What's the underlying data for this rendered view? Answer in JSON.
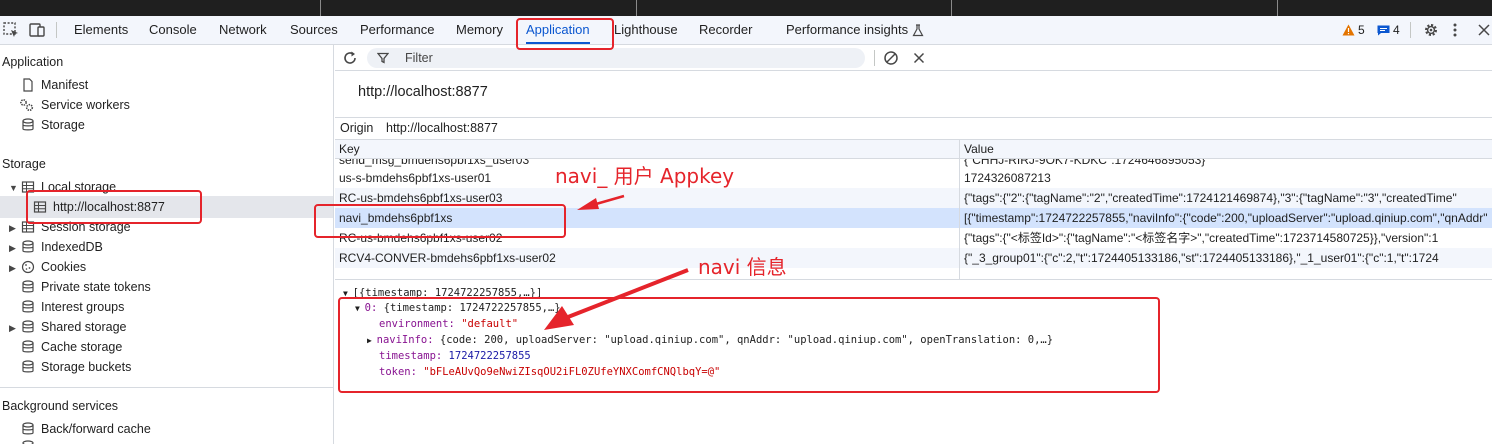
{
  "tabs": [
    {
      "label": "Elements"
    },
    {
      "label": "Console"
    },
    {
      "label": "Network"
    },
    {
      "label": "Sources"
    },
    {
      "label": "Performance"
    },
    {
      "label": "Memory"
    },
    {
      "label": "Application"
    },
    {
      "label": "Lighthouse"
    },
    {
      "label": "Recorder"
    },
    {
      "label": "Performance insights"
    }
  ],
  "badges": {
    "warnings": "5",
    "messages": "4"
  },
  "sidebar": {
    "application_title": "Application",
    "app_items": [
      {
        "label": "Manifest",
        "icon": "file-icon"
      },
      {
        "label": "Service workers",
        "icon": "gears-icon"
      },
      {
        "label": "Storage",
        "icon": "database-icon"
      }
    ],
    "storage_title": "Storage",
    "storage_items": [
      {
        "label": "Local storage"
      },
      {
        "label": "http://localhost:8877"
      },
      {
        "label": "Session storage"
      },
      {
        "label": "IndexedDB"
      },
      {
        "label": "Cookies"
      },
      {
        "label": "Private state tokens"
      },
      {
        "label": "Interest groups"
      },
      {
        "label": "Shared storage"
      },
      {
        "label": "Cache storage"
      },
      {
        "label": "Storage buckets"
      }
    ],
    "bg_title": "Background services",
    "bg_items": [
      {
        "label": "Back/forward cache"
      }
    ]
  },
  "toolbar": {
    "filter_placeholder": "Filter"
  },
  "origin": {
    "title": "http://localhost:8877",
    "label": "Origin",
    "value": "http://localhost:8877"
  },
  "table": {
    "headers": {
      "key": "Key",
      "value": "Value"
    },
    "rows": [
      {
        "key": "send_msg_bmdehs6pbf1xs_user03",
        "value": "{\"CHHJ-RIRJ-9OK7-KDKC\":1724646895053}"
      },
      {
        "key": "us-s-bmdehs6pbf1xs-user01",
        "value": "1724326087213"
      },
      {
        "key": "RC-us-bmdehs6pbf1xs-user03",
        "value": "{\"tags\":{\"2\":{\"tagName\":\"2\",\"createdTime\":1724121469874},\"3\":{\"tagName\":\"3\",\"createdTime\""
      },
      {
        "key": "navi_bmdehs6pbf1xs",
        "value": "[{\"timestamp\":1724722257855,\"naviInfo\":{\"code\":200,\"uploadServer\":\"upload.qiniup.com\",\"qnAddr\""
      },
      {
        "key": "RC-us-bmdehs6pbf1xs-user02",
        "value": "{\"tags\":{\"<标签Id>\":{\"tagName\":\"<标签名字>\",\"createdTime\":1723714580725}},\"version\":1"
      },
      {
        "key": "RCV4-CONVER-bmdehs6pbf1xs-user02",
        "value": "{\"_3_group01\":{\"c\":2,\"t\":1724405133186,\"st\":1724405133186},\"_1_user01\":{\"c\":1,\"t\":1724"
      }
    ]
  },
  "preview": {
    "root": "[{timestamp: 1724722257855,…}]",
    "item_index": "0:",
    "item_summary": "{timestamp: 1724722257855,…}",
    "fields": [
      {
        "key": "environment:",
        "value": "\"default\"",
        "kind": "str"
      },
      {
        "key": "naviInfo:",
        "value": "{code: 200, uploadServer: \"upload.qiniup.com\", qnAddr: \"upload.qiniup.com\", openTranslation: 0,…}",
        "kind": "obj"
      },
      {
        "key": "timestamp:",
        "value": "1724722257855",
        "kind": "num"
      },
      {
        "key": "token:",
        "value": "\"bFLeAUvQo9eNwiZIsqOU2iFL0ZUfeYNXComfCNQlbqY=@\"",
        "kind": "str"
      }
    ]
  },
  "annotations": {
    "appkey_note": "navi_ 用户 Appkey",
    "info_note": "navi 信息"
  },
  "colors": {
    "accent": "#0b57d0",
    "annotation": "#e5242b",
    "selected_row": "#d3e3fd"
  }
}
